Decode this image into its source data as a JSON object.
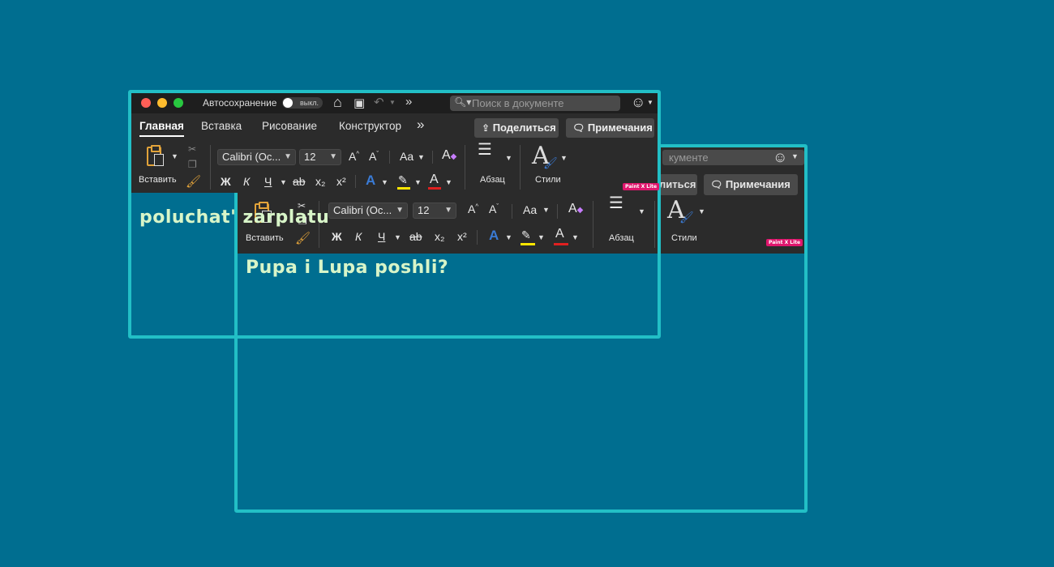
{
  "window_front": {
    "autosave_label": "Автосохранение",
    "autosave_state": "выкл.",
    "search_placeholder": "Поиск в документе",
    "tabs": [
      {
        "label": "Главная",
        "active": true
      },
      {
        "label": "Вставка",
        "active": false
      },
      {
        "label": "Рисование",
        "active": false
      },
      {
        "label": "Конструктор",
        "active": false
      }
    ],
    "more_tabs": "»",
    "share_label": "Поделиться",
    "comments_label": "Примечания",
    "paste_label": "Вставить",
    "font_name": "Calibri (Ос...",
    "font_size": "12",
    "change_case": "Aa",
    "bold": "Ж",
    "italic": "К",
    "underline": "Ч",
    "strike": "ab",
    "subscript": "x₂",
    "superscript": "x²",
    "paragraph_label": "Абзац",
    "styles_label": "Стили",
    "badge": "Paint X Lite",
    "doc_text": "poluchat' zarplatu"
  },
  "window_back": {
    "search_fragment": "кументе",
    "share_fragment": "литься",
    "comments_label": "Примечания",
    "paste_label": "Вставить",
    "font_name": "Calibri (Oc...",
    "font_size": "12",
    "change_case": "Aa",
    "bold": "Ж",
    "italic": "К",
    "underline": "Ч",
    "strike": "ab",
    "subscript": "x₂",
    "superscript": "x²",
    "paragraph_label": "Абзац",
    "styles_label": "Стили",
    "badge": "Paint X Lite",
    "doc_text": "Pupa i Lupa poshli?"
  },
  "colors": {
    "background": "#006e90",
    "frame": "#22bfc6",
    "ribbon": "#2b2b2b",
    "highlight_yellow": "#ffe600",
    "font_red": "#e02020",
    "text_effects_blue": "#3a7bd5",
    "doc_text": "#d8f5c8"
  }
}
